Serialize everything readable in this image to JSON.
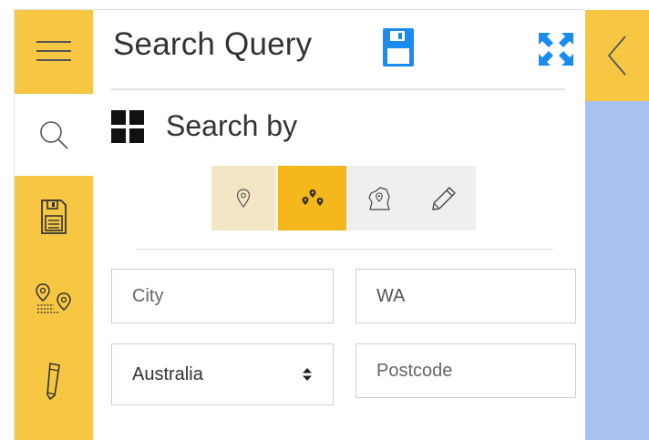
{
  "header": {
    "title": "Search Query",
    "save_icon": "save-icon",
    "expand_icon": "expand-icon"
  },
  "rail": {
    "items": [
      {
        "name": "menu",
        "icon": "hamburger-icon",
        "active": false
      },
      {
        "name": "search",
        "icon": "search-icon",
        "active": true
      },
      {
        "name": "saved",
        "icon": "floppy-document-icon",
        "active": false
      },
      {
        "name": "route",
        "icon": "route-pins-icon",
        "active": false
      },
      {
        "name": "draw",
        "icon": "pencil-icon",
        "active": false
      }
    ]
  },
  "search_by": {
    "label": "Search by",
    "icon": "grid-icon",
    "modes": [
      {
        "name": "single-location",
        "icon": "map-pin-icon",
        "state": "hover"
      },
      {
        "name": "multi-location",
        "icon": "multi-pin-icon",
        "state": "selected"
      },
      {
        "name": "region",
        "icon": "region-pin-icon",
        "state": "default"
      },
      {
        "name": "freehand",
        "icon": "pencil-icon",
        "state": "default"
      }
    ]
  },
  "form": {
    "city_placeholder": "City",
    "city_value": "",
    "state_value": "WA",
    "country_selected": "Australia",
    "postcode_placeholder": "Postcode",
    "postcode_value": ""
  },
  "colors": {
    "accent": "#f7c744",
    "selected": "#f5b81c",
    "hover": "#f3e6c4",
    "save_icon": "#1a8cf0",
    "map": "#a8c1ef"
  },
  "collapse": {
    "icon": "chevron-left-icon"
  }
}
